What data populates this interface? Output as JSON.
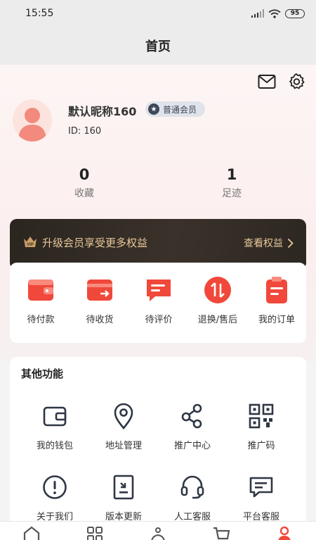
{
  "status_bar": {
    "time": "15:55",
    "battery": "95"
  },
  "nav": {
    "title": "首页"
  },
  "profile": {
    "nickname": "默认昵称160",
    "member_level": "普通会员",
    "user_id": "ID: 160",
    "stats": [
      {
        "value": "0",
        "label": "收藏"
      },
      {
        "value": "1",
        "label": "足迹"
      }
    ]
  },
  "vip": {
    "promo_text": "升级会员享受更多权益",
    "link_text": "查看权益",
    "accent": "#e8c89a"
  },
  "orders": {
    "items": [
      {
        "label": "待付款",
        "icon": "wallet-icon"
      },
      {
        "label": "待收货",
        "icon": "delivery-card-icon"
      },
      {
        "label": "待评价",
        "icon": "comment-icon"
      },
      {
        "label": "退换/售后",
        "icon": "exchange-icon"
      },
      {
        "label": "我的订单",
        "icon": "clipboard-icon"
      }
    ],
    "accent": "#f0483a"
  },
  "other": {
    "title": "其他功能",
    "items": [
      {
        "label": "我的钱包",
        "icon": "wallet-outline-icon"
      },
      {
        "label": "地址管理",
        "icon": "location-pin-icon"
      },
      {
        "label": "推广中心",
        "icon": "share-nodes-icon"
      },
      {
        "label": "推广码",
        "icon": "qr-code-icon"
      },
      {
        "label": "关于我们",
        "icon": "info-circle-icon"
      },
      {
        "label": "版本更新",
        "icon": "update-doc-icon"
      },
      {
        "label": "人工客服",
        "icon": "headset-icon"
      },
      {
        "label": "平台客服",
        "icon": "chat-bubble-icon"
      }
    ]
  },
  "tab_bar": {
    "items": [
      {
        "icon": "home-icon"
      },
      {
        "icon": "category-grid-icon"
      },
      {
        "icon": "community-icon"
      },
      {
        "icon": "cart-icon"
      },
      {
        "icon": "profile-icon",
        "active": true
      }
    ],
    "active_color": "#f0483a"
  }
}
